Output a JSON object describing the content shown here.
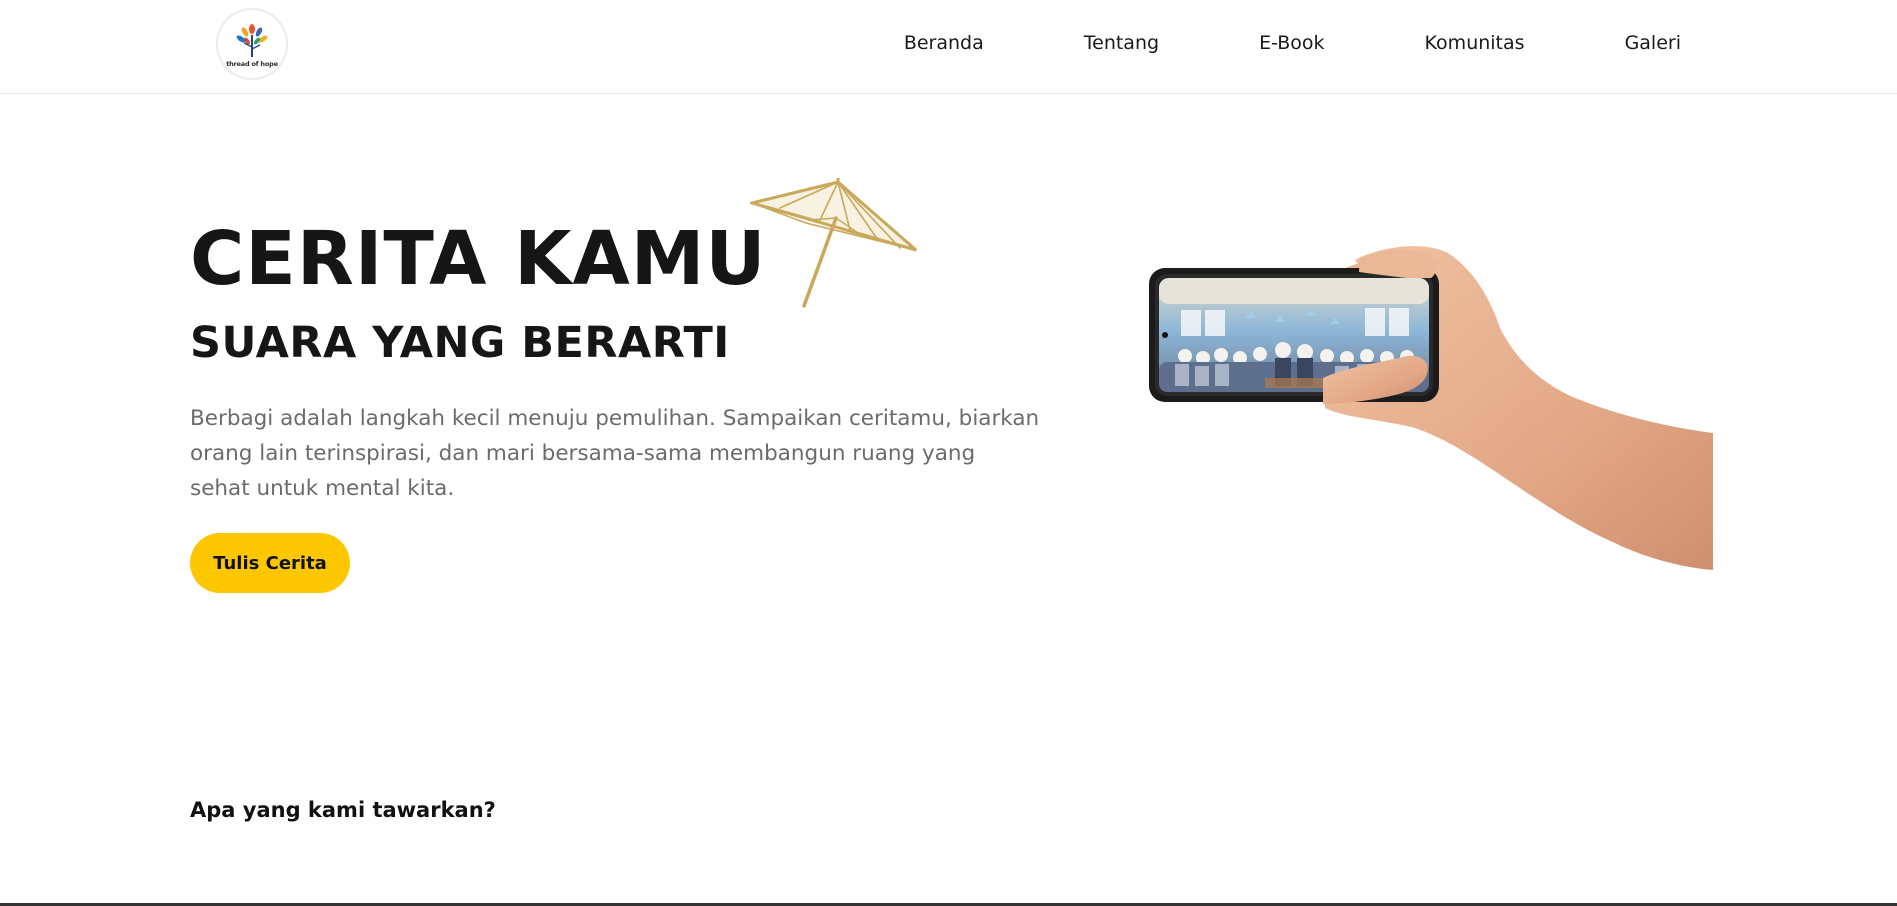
{
  "brand": {
    "logo_text": "thread of hope"
  },
  "nav": {
    "items": [
      {
        "label": "Beranda"
      },
      {
        "label": "Tentang"
      },
      {
        "label": "E-Book"
      },
      {
        "label": "Komunitas"
      },
      {
        "label": "Galeri"
      }
    ]
  },
  "hero": {
    "title": "CERITA KAMU",
    "subtitle": "SUARA YANG BERARTI",
    "description": "Berbagi adalah langkah kecil menuju pemulihan. Sampaikan ceritamu, biarkan orang lain terinspirasi, dan mari bersama-sama membangun ruang yang sehat untuk mental kita.",
    "cta_label": "Tulis Cerita"
  },
  "offer": {
    "heading": "Apa yang kami tawarkan?"
  },
  "colors": {
    "accent": "#fdc700",
    "umbrella": "#c9a85a",
    "text": "#161616",
    "muted": "#6b6b6b"
  },
  "icons": {
    "logo": "tree-logo-icon",
    "decor": "umbrella-icon"
  }
}
